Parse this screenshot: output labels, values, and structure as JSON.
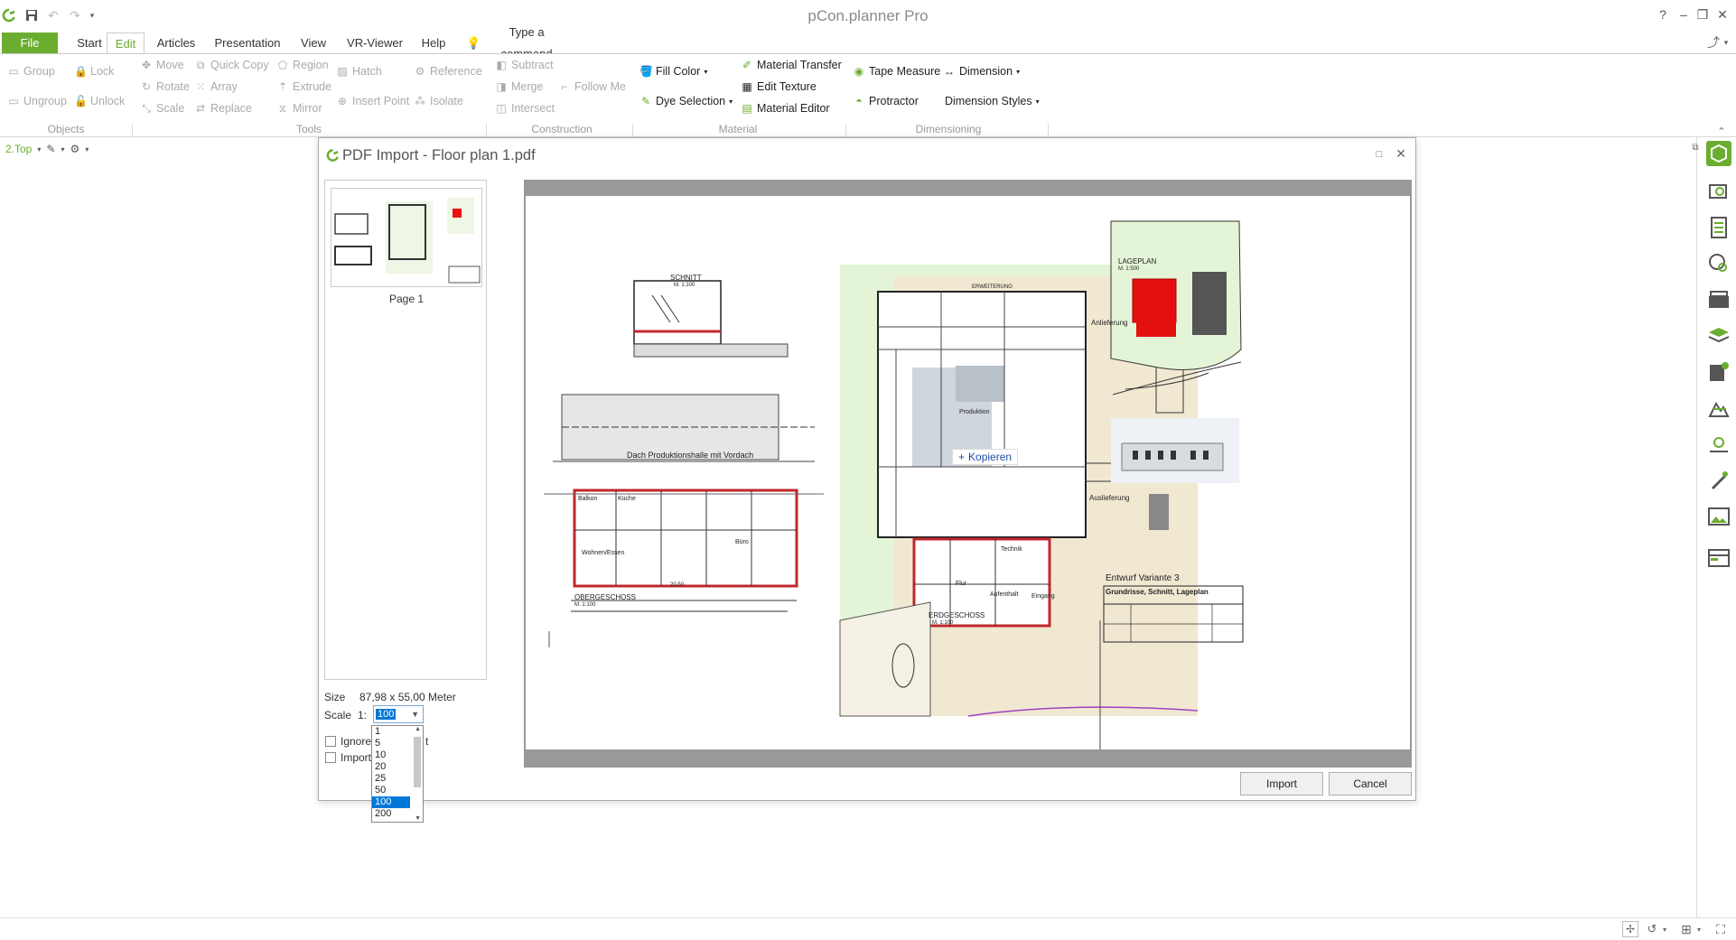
{
  "app": {
    "title": "pCon.planner Pro",
    "accent": "#6bad2e"
  },
  "window_controls": {
    "help": "?",
    "minimize": "–",
    "restore": "❐",
    "close": "✕"
  },
  "menu": {
    "file": "File",
    "tabs": [
      "Start",
      "Edit",
      "Articles",
      "Presentation",
      "View",
      "VR-Viewer",
      "Help"
    ],
    "active_tab": "Edit",
    "command_box": "Type a command"
  },
  "ribbon": {
    "objects": {
      "group": "Group",
      "lock": "Lock",
      "ungroup": "Ungroup",
      "unlock": "Unlock",
      "label": "Objects"
    },
    "tools": {
      "move": "Move",
      "quick_copy": "Quick Copy",
      "region": "Region",
      "hatch": "Hatch",
      "reference": "Reference",
      "rotate": "Rotate",
      "array": "Array",
      "extrude": "Extrude",
      "insert_point": "Insert Point",
      "isolate": "Isolate",
      "scale": "Scale",
      "replace": "Replace",
      "mirror": "Mirror",
      "label": "Tools"
    },
    "construction": {
      "subtract": "Subtract",
      "merge": "Merge",
      "follow_me": "Follow Me",
      "intersect": "Intersect",
      "label": "Construction"
    },
    "material": {
      "fill_color": "Fill Color",
      "dye_selection": "Dye Selection",
      "material_transfer": "Material Transfer",
      "edit_texture": "Edit Texture",
      "material_editor": "Material Editor",
      "label": "Material"
    },
    "dimensioning": {
      "tape_measure": "Tape Measure",
      "dimension": "Dimension",
      "protractor": "Protractor",
      "dimension_styles": "Dimension Styles",
      "label": "Dimensioning"
    }
  },
  "viewport": {
    "view_name": "2.Top"
  },
  "dialog": {
    "title": "PDF Import - Floor plan 1.pdf",
    "page_label": "Page 1",
    "size_label": "Size",
    "size_value": "87,98 x 55,00 Meter",
    "scale_label": "Scale",
    "scale_prefix": "1:",
    "scale_value": "100",
    "scale_options": [
      "1",
      "5",
      "10",
      "20",
      "25",
      "50",
      "100",
      "200"
    ],
    "ignore_label": "Ignore",
    "ignore_tail": "t",
    "import_check_label": "Import",
    "import_button": "Import",
    "cancel_button": "Cancel",
    "tooltip": "Kopieren"
  },
  "plan_labels": {
    "schnitt": "SCHNITT",
    "schnitt_scale": "M. 1:100",
    "dach": "Dach Produktionshalle mit Vordach",
    "obergeschoss": "OBERGESCHOSS",
    "og_scale": "M. 1:100",
    "erdgeschoss": "ERDGESCHOSS",
    "eg_scale": "M. 1:100",
    "lageplan": "LAGEPLAN",
    "lp_scale": "M. 1:500",
    "entwurf": "Entwurf Variante 3",
    "grundrisse": "Grundrisse, Schnitt, Lageplan",
    "anlieferung": "Anlieferung",
    "auslieferung": "Auslieferung",
    "erweiterung": "ERWEITERUNG",
    "produktion": "Produktion",
    "technik": "Technik",
    "flur": "Flur",
    "aufenthalt": "Aufenthalt",
    "eingang": "Eingang",
    "kuche": "Küche",
    "balkon": "Balkon",
    "wohnen": "Wohnen/Essen",
    "buro": "Büro",
    "dim_20_50": "20,50"
  }
}
